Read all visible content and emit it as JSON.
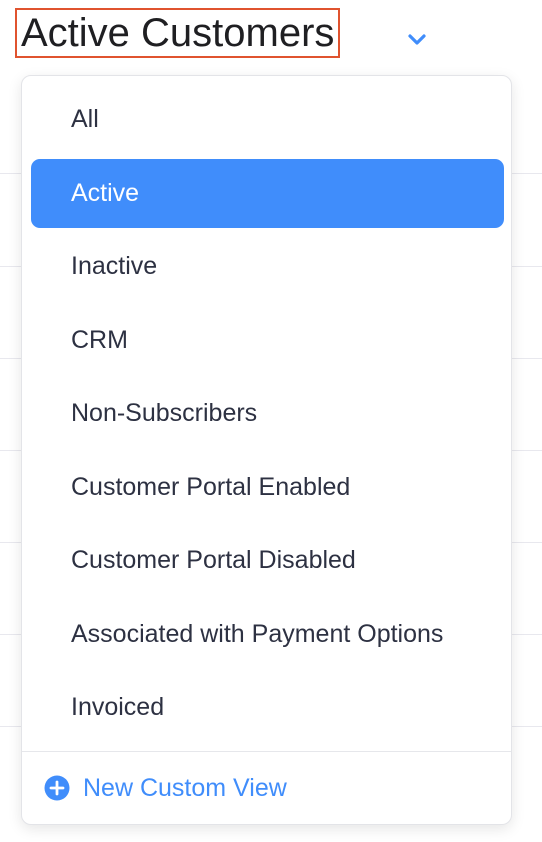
{
  "header": {
    "title": "Active Customers",
    "chevron_icon": "chevron-down-icon"
  },
  "dropdown": {
    "items": [
      {
        "label": "All",
        "selected": false
      },
      {
        "label": "Active",
        "selected": true
      },
      {
        "label": "Inactive",
        "selected": false
      },
      {
        "label": "CRM",
        "selected": false
      },
      {
        "label": "Non-Subscribers",
        "selected": false
      },
      {
        "label": "Customer Portal Enabled",
        "selected": false
      },
      {
        "label": "Customer Portal Disabled",
        "selected": false
      },
      {
        "label": "Associated with Payment Options",
        "selected": false
      },
      {
        "label": "Invoiced",
        "selected": false
      }
    ],
    "footer": {
      "icon": "plus-circle-icon",
      "label": "New Custom View"
    }
  },
  "colors": {
    "accent": "#408dfb",
    "title_border": "#e0532f",
    "text": "#2d3142"
  }
}
